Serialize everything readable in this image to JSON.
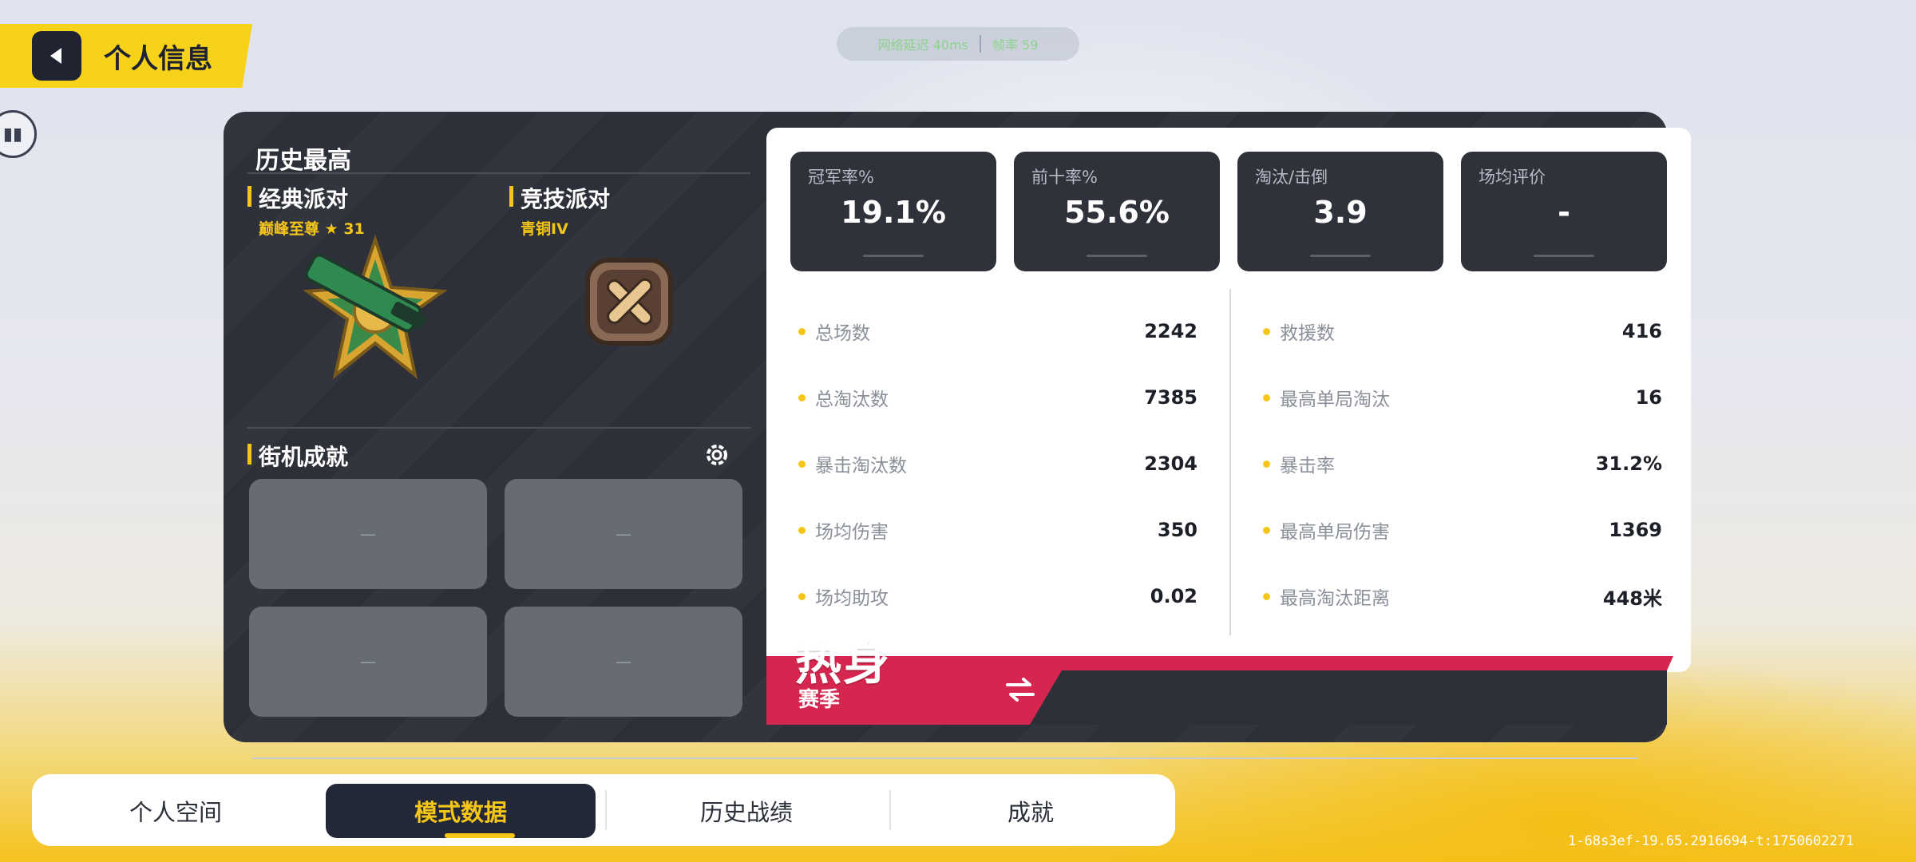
{
  "header": {
    "title": "个人信息"
  },
  "network": {
    "left": "网络延迟 40ms",
    "right": "帧率 59"
  },
  "history": {
    "title": "历史最高",
    "modes": [
      {
        "name": "经典派对",
        "rank": "巅峰至尊",
        "stars": "31"
      },
      {
        "name": "竞技派对",
        "rank": "青铜IV"
      }
    ]
  },
  "arcade": {
    "title": "街机成就",
    "slots": [
      "—",
      "—",
      "—",
      "—"
    ]
  },
  "top_stats": [
    {
      "label": "冠军率%",
      "value": "19.1%"
    },
    {
      "label": "前十率%",
      "value": "55.6%"
    },
    {
      "label": "淘汰/击倒",
      "value": "3.9"
    },
    {
      "label": "场均评价",
      "value": "-"
    }
  ],
  "stats_left": [
    {
      "name": "总场数",
      "value": "2242"
    },
    {
      "name": "总淘汰数",
      "value": "7385"
    },
    {
      "name": "暴击淘汰数",
      "value": "2304"
    },
    {
      "name": "场均伤害",
      "value": "350"
    },
    {
      "name": "场均助攻",
      "value": "0.02"
    }
  ],
  "stats_right": [
    {
      "name": "救援数",
      "value": "416"
    },
    {
      "name": "最高单局淘汰",
      "value": "16"
    },
    {
      "name": "暴击率",
      "value": "31.2%"
    },
    {
      "name": "最高单局伤害",
      "value": "1369"
    },
    {
      "name": "最高淘汰距离",
      "value": "448米"
    }
  ],
  "season": {
    "name": "热身",
    "label": "赛季"
  },
  "tabs": [
    {
      "label": "个人空间",
      "active": false
    },
    {
      "label": "模式数据",
      "active": true
    },
    {
      "label": "历史战绩",
      "active": false
    },
    {
      "label": "成就",
      "active": false
    }
  ],
  "build_id": "1-68s3ef-19.65.2916694-t:1750602271",
  "colors": {
    "accent": "#f5c518",
    "panel": "#2d3038",
    "season_red": "#d4264e"
  }
}
